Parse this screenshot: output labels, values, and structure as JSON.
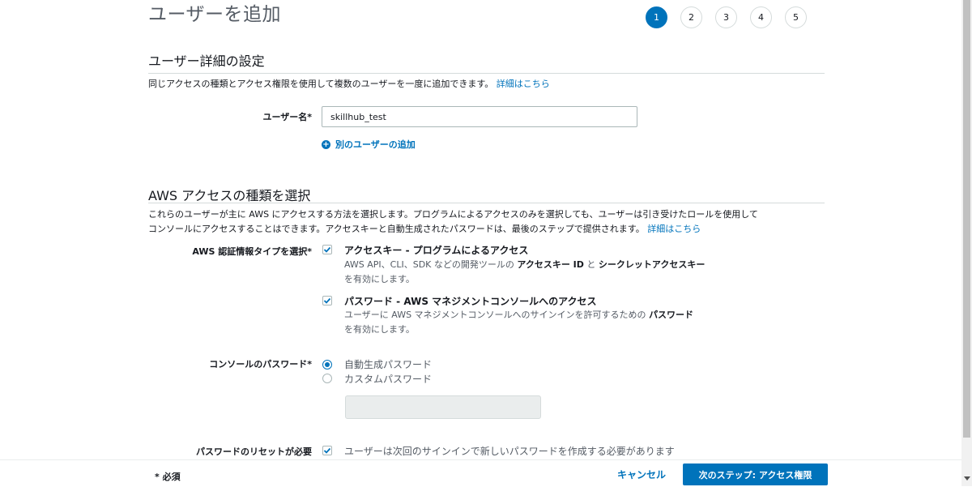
{
  "page_title": "ユーザーを追加",
  "steps": [
    "1",
    "2",
    "3",
    "4",
    "5"
  ],
  "section1": {
    "title": "ユーザー詳細の設定",
    "desc": "同じアクセスの種類とアクセス権限を使用して複数のユーザーを一度に追加できます。",
    "desc_link": "詳細はこちら",
    "username_label": "ユーザー名*",
    "username_value": "skillhub_test",
    "add_user_link": "別のユーザーの追加"
  },
  "section2": {
    "title": "AWS アクセスの種類を選択",
    "desc_line1": "これらのユーザーが主に AWS にアクセスする方法を選択します。プログラムによるアクセスのみを選択しても、ユーザーは引き受けたロールを使用して",
    "desc_line2": "コンソールにアクセスすることはできます。アクセスキーと自動生成されたパスワードは、最後のステップで提供されます。",
    "desc_link": "詳細はこちら",
    "cred_label": "AWS 認証情報タイプを選択*",
    "opt1_title": "アクセスキー - プログラムによるアクセス",
    "opt1_desc_a": "AWS API、CLI、SDK などの開発ツールの",
    "opt1_desc_b": "アクセスキー ID",
    "opt1_desc_c": "と",
    "opt1_desc_d": "シークレットアクセスキー",
    "opt1_desc_e": "を有効にします。",
    "opt2_title": "パスワード - AWS マネジメントコンソールへのアクセス",
    "opt2_desc_a": "ユーザーに AWS マネジメントコンソールへのサインインを許可するための",
    "opt2_desc_b": "パスワード",
    "opt2_desc_c": "を有効にします。",
    "console_pw_label": "コンソールのパスワード*",
    "radio_auto": "自動生成パスワード",
    "radio_custom": "カスタムパスワード",
    "reset_label": "パスワードのリセットが必要",
    "reset_text": "ユーザーは次回のサインインで新しいパスワードを作成する必要があります"
  },
  "footer": {
    "required": "* 必須",
    "cancel": "キャンセル",
    "next": "次のステップ: アクセス権限"
  },
  "colors": {
    "accent": "#0073bb",
    "text": "#16191f",
    "muted": "#545b64"
  }
}
